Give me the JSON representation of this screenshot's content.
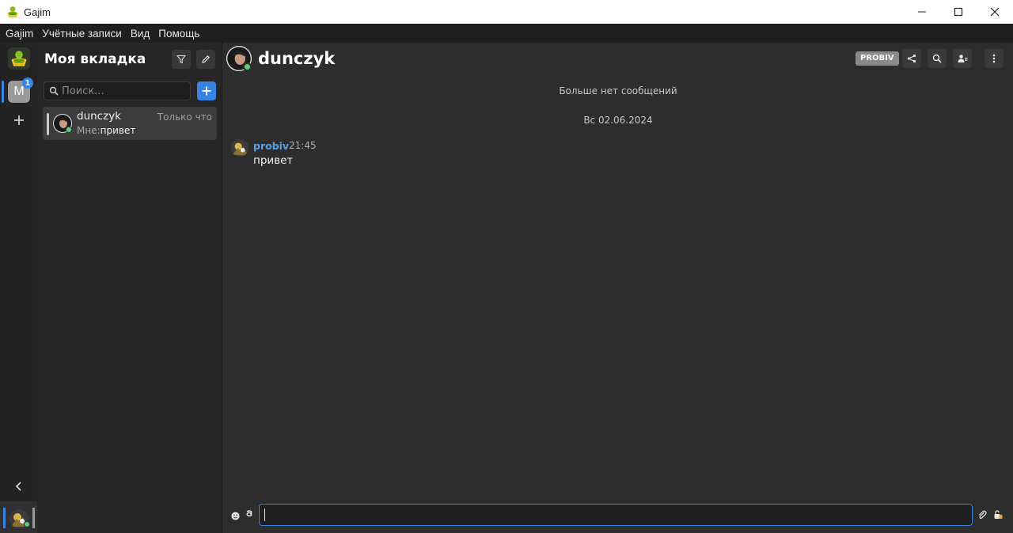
{
  "window": {
    "title": "Gajim",
    "controls": {
      "minimize": "minimize-icon",
      "maximize": "maximize-icon",
      "close": "close-icon"
    }
  },
  "menu": {
    "items": [
      "Gajim",
      "Учётные записи",
      "Вид",
      "Помощь"
    ]
  },
  "rail": {
    "workspace_letter": "M",
    "workspace_badge": "1"
  },
  "chatlist": {
    "workspace_title": "Моя вкладка",
    "search_placeholder": "Поиск...",
    "chats": [
      {
        "name": "dunczyk",
        "time": "Только что",
        "preview_prefix": "Мне:",
        "preview_text": "привет"
      }
    ]
  },
  "chat": {
    "contact_name": "dunczyk",
    "account_badge": "PROBIV",
    "no_more_messages": "Больше нет сообщений",
    "date_separator": "Вс 02.06.2024",
    "messages": [
      {
        "author": "probiv",
        "time": "21:45",
        "text": "привет"
      }
    ],
    "input_value": ""
  },
  "colors": {
    "accent": "#3584e4",
    "online": "#57d27a",
    "author": "#5aa0e8"
  }
}
